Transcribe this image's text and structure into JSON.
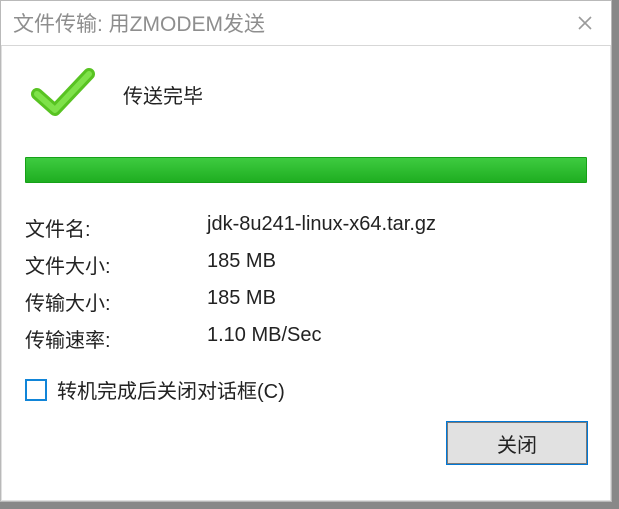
{
  "window": {
    "title": "文件传输: 用ZMODEM发送"
  },
  "status": {
    "text": "传送完毕"
  },
  "progress": {
    "percent": 100
  },
  "info": {
    "filename_label": "文件名:",
    "filename_value": "jdk-8u241-linux-x64.tar.gz",
    "filesize_label": "文件大小:",
    "filesize_value": "185 MB",
    "transfersize_label": "传输大小:",
    "transfersize_value": "185 MB",
    "rate_label": "传输速率:",
    "rate_value": "1.10 MB/Sec"
  },
  "option": {
    "close_when_done_label": "转机完成后关闭对话框(C)",
    "close_when_done_checked": false
  },
  "buttons": {
    "close_label": "关闭"
  }
}
